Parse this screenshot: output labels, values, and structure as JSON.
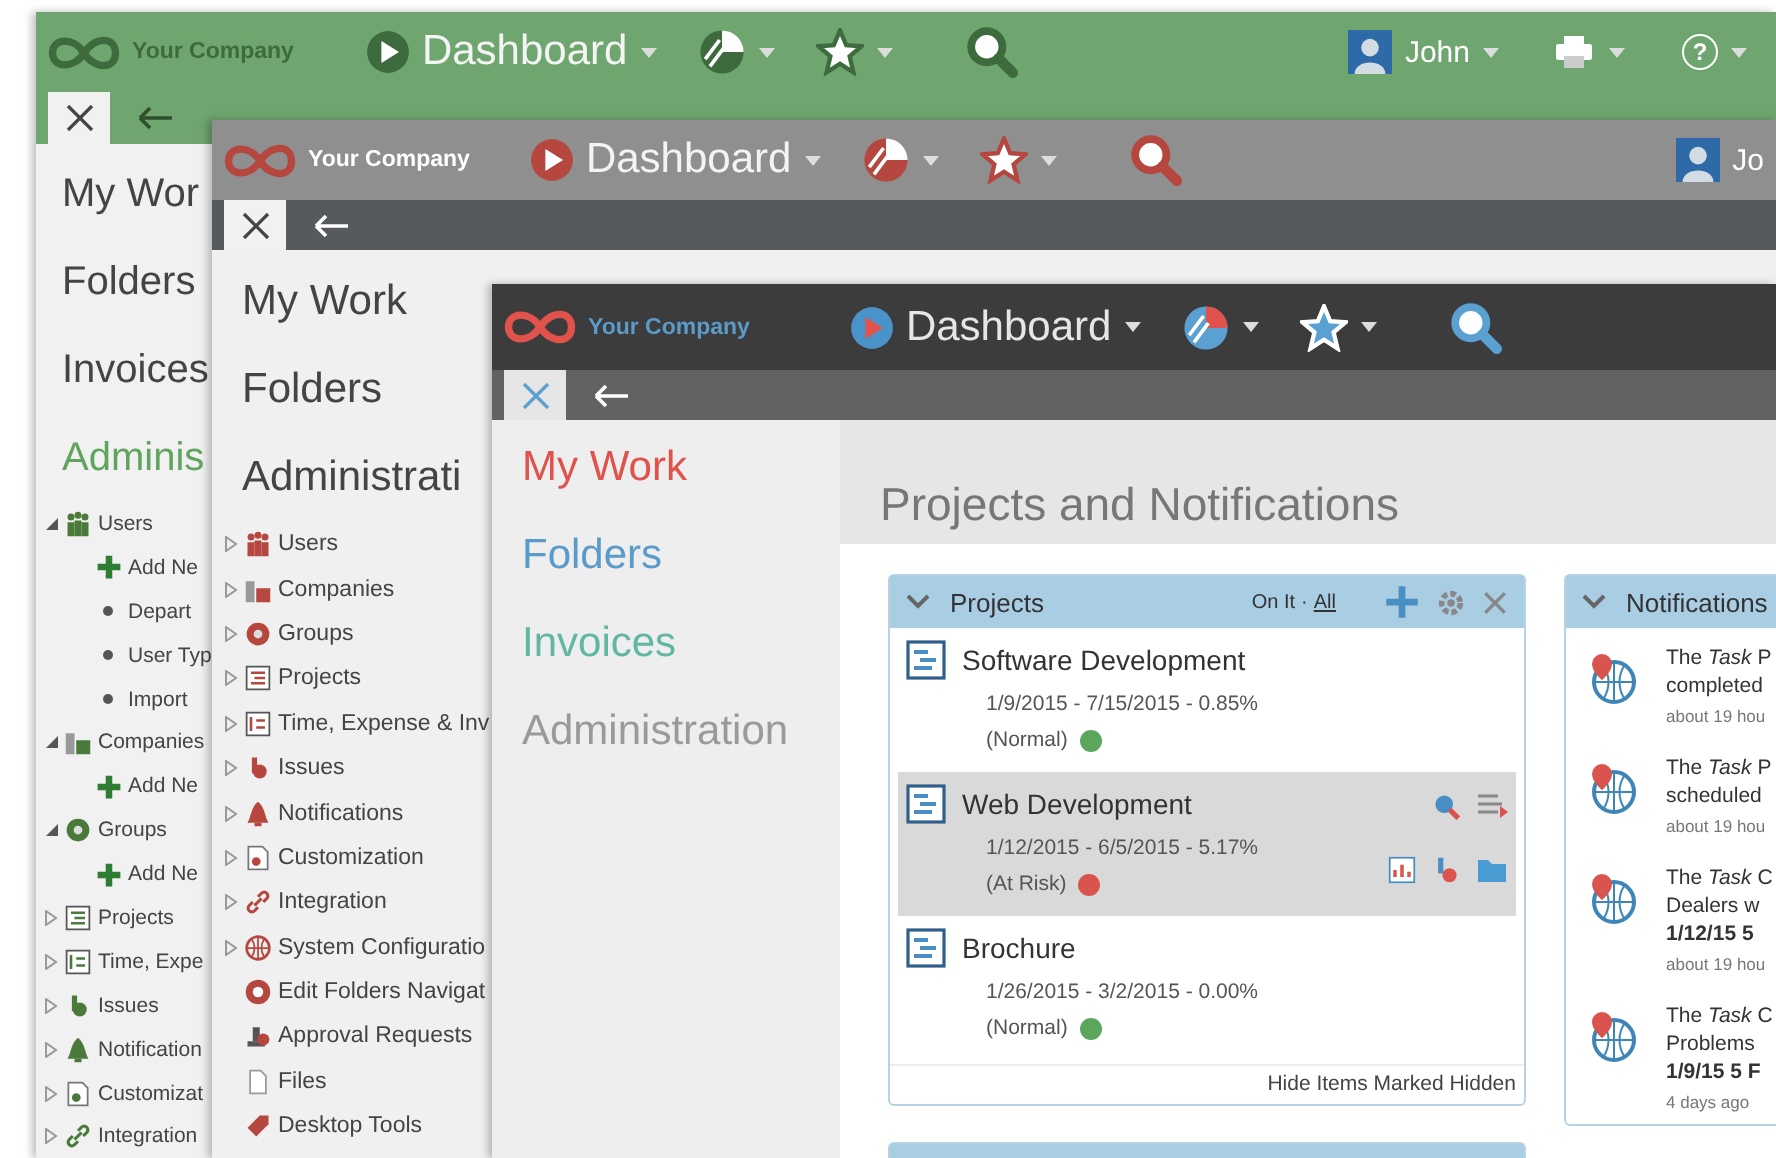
{
  "windows": [
    {
      "topbar": {
        "company": "Your Company",
        "menu": "Dashboard",
        "user": "John",
        "help": "?"
      },
      "nav": [
        {
          "label": "My Wor",
          "selected": false
        },
        {
          "label": "Folders",
          "selected": false
        },
        {
          "label": "Invoices",
          "selected": false
        },
        {
          "label": "Adminis",
          "selected": true
        }
      ],
      "tree": [
        {
          "label": "Users",
          "expanded": true,
          "children": [
            {
              "label": "Add Ne",
              "kind": "add"
            },
            {
              "label": "Depart",
              "kind": "link"
            },
            {
              "label": "User Typ",
              "kind": "link"
            },
            {
              "label": "Import",
              "kind": "link"
            }
          ]
        },
        {
          "label": "Companies",
          "expanded": true,
          "children": [
            {
              "label": "Add Ne",
              "kind": "add"
            }
          ]
        },
        {
          "label": "Groups",
          "expanded": true,
          "children": [
            {
              "label": "Add Ne",
              "kind": "add"
            }
          ]
        },
        {
          "label": "Projects",
          "expanded": false
        },
        {
          "label": "Time, Expe",
          "expanded": false
        },
        {
          "label": "Issues",
          "expanded": false
        },
        {
          "label": "Notification",
          "expanded": false
        },
        {
          "label": "Customizat",
          "expanded": false
        },
        {
          "label": "Integration",
          "expanded": false
        }
      ]
    },
    {
      "topbar": {
        "company": "Your Company",
        "menu": "Dashboard",
        "user": "Jo"
      },
      "nav": [
        {
          "label": "My Work",
          "selected": false
        },
        {
          "label": "Folders",
          "selected": false
        },
        {
          "label": "Administrati",
          "selected": false
        }
      ],
      "tree": [
        {
          "label": "Users",
          "expanded": false
        },
        {
          "label": "Companies",
          "expanded": false
        },
        {
          "label": "Groups",
          "expanded": false
        },
        {
          "label": "Projects",
          "expanded": false
        },
        {
          "label": "Time, Expense & Inv",
          "expanded": false
        },
        {
          "label": "Issues",
          "expanded": false
        },
        {
          "label": "Notifications",
          "expanded": false
        },
        {
          "label": "Customization",
          "expanded": false
        },
        {
          "label": "Integration",
          "expanded": false
        },
        {
          "label": "System Configuratio",
          "expanded": false
        },
        {
          "label": "Edit Folders Navigat"
        },
        {
          "label": "Approval Requests"
        },
        {
          "label": "Files"
        },
        {
          "label": "Desktop Tools"
        }
      ]
    },
    {
      "topbar": {
        "company": "Your Company",
        "menu": "Dashboard"
      },
      "nav": [
        {
          "label": "My Work",
          "color": "#e0524b"
        },
        {
          "label": "Folders",
          "color": "#5b9bc9"
        },
        {
          "label": "Invoices",
          "color": "#62b7a2"
        },
        {
          "label": "Administration",
          "color": "#9a9a9a"
        }
      ],
      "content": {
        "heading": "Projects and Notifications",
        "projects": {
          "title": "Projects",
          "filter": "On It",
          "separator": "·",
          "link": "All",
          "rows": [
            {
              "name": "Software Development",
              "dates": "1/9/2015 - 7/15/2015 - 0.85%",
              "status": "(Normal)",
              "color": "#5ba65b",
              "selected": false
            },
            {
              "name": "Web Development",
              "dates": "1/12/2015 - 6/5/2015 - 5.17%",
              "status": "(At Risk)",
              "color": "#d9534f",
              "selected": true
            },
            {
              "name": "Brochure",
              "dates": "1/26/2015 - 3/2/2015 - 0.00%",
              "status": "(Normal)",
              "color": "#5ba65b",
              "selected": false
            }
          ],
          "footer": "Hide Items Marked Hidden"
        },
        "notifications": {
          "title": "Notifications",
          "items": [
            {
              "lines": [
                "The *Task* P",
                "completed"
              ],
              "time": "about 19 hou"
            },
            {
              "lines": [
                "The *Task* P",
                "scheduled"
              ],
              "time": "about 19 hou"
            },
            {
              "lines": [
                "The *Task* C",
                "Dealers w",
                "**1/12/15 5**"
              ],
              "time": "about 19 hou"
            },
            {
              "lines": [
                "The *Task* C",
                "Problems",
                "**1/9/15 5 F**"
              ],
              "time": "4 days ago"
            }
          ]
        }
      }
    }
  ]
}
